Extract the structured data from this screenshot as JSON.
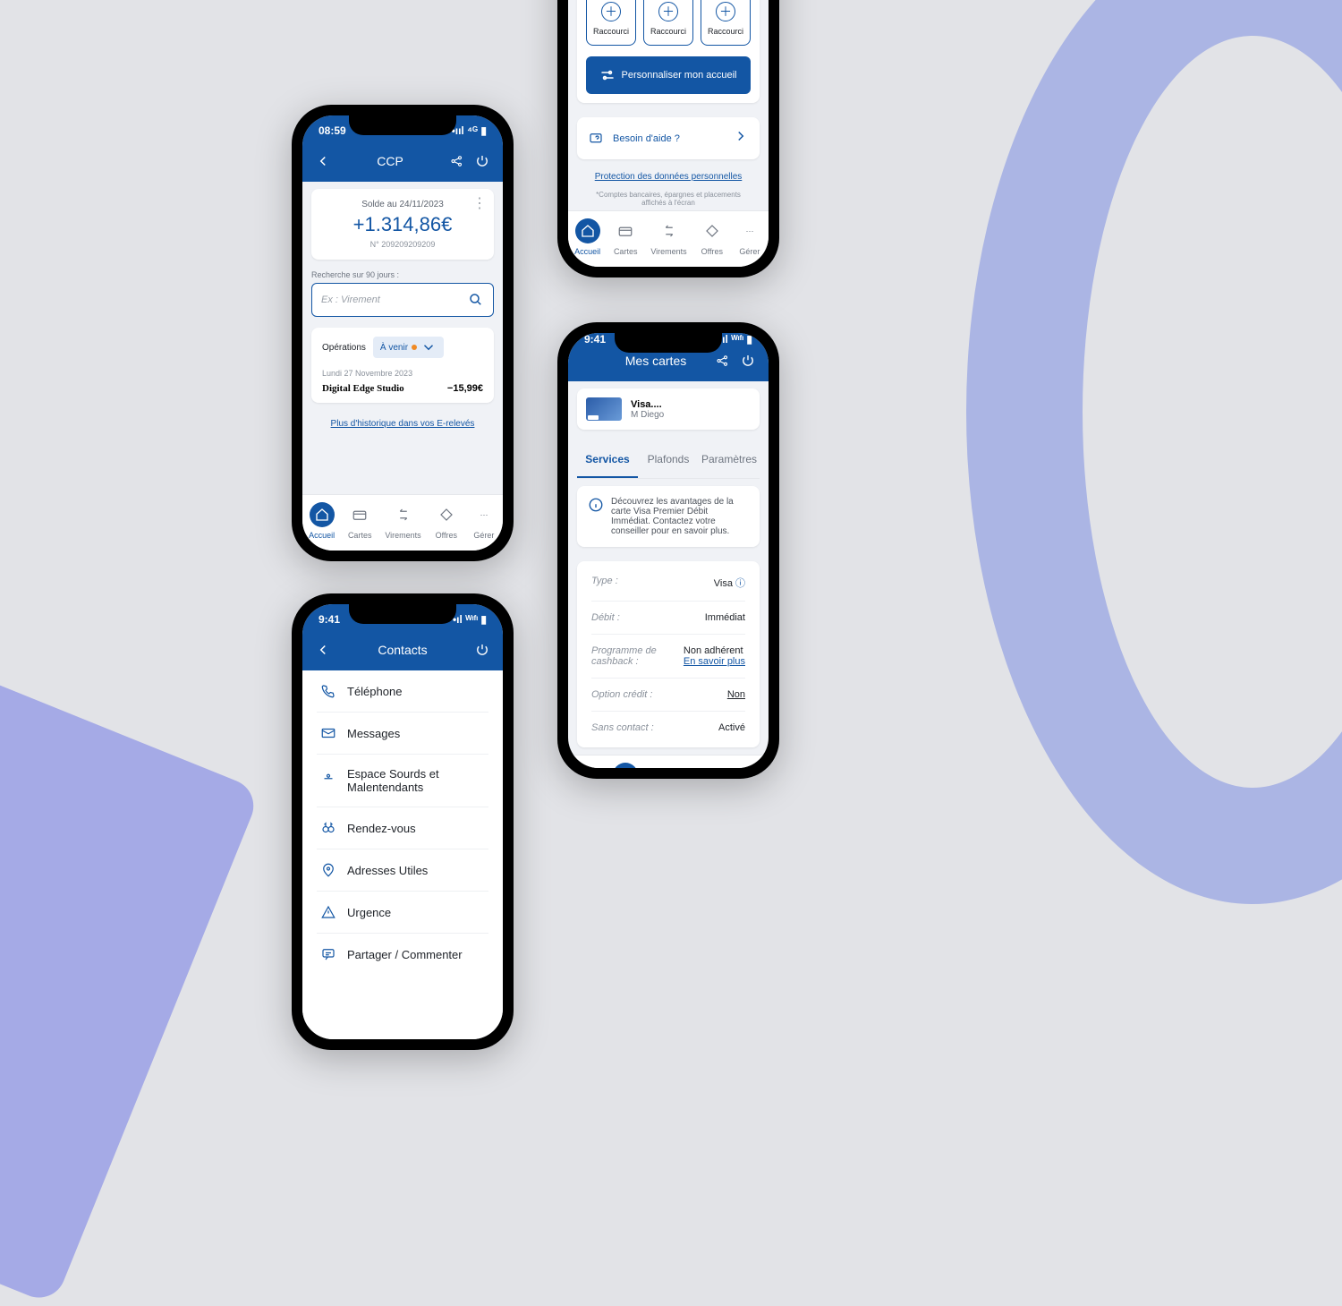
{
  "status": {
    "time1": "08:59",
    "time2": "9:41"
  },
  "tabs": [
    "Accueil",
    "Cartes",
    "Virements",
    "Offres",
    "Gérer"
  ],
  "ccp": {
    "title": "CCP",
    "balanceLabel": "Solde au 24/11/2023",
    "balance": "+1.314,86€",
    "acct": "N° 209209209209",
    "searchLabel": "Recherche sur 90 jours :",
    "searchPh": "Ex : Virement",
    "opsLabel": "Opérations",
    "upcoming": "À venir",
    "date": "Lundi 27 Novembre 2023",
    "merchant": "Digital Edge Studio",
    "amount": "−15,99€",
    "more": "Plus d'historique dans vos E-relevés"
  },
  "home": {
    "shortcut": "Raccourci",
    "personalize": "Personnaliser mon accueil",
    "help": "Besoin d'aide ?",
    "privacy": "Protection des données personnelles",
    "note": "*Comptes bancaires, épargnes et placements affichés à l'écran"
  },
  "cards": {
    "title": "Mes cartes",
    "cardName": "Visa....",
    "holder": "M Diego",
    "tabs": [
      "Services",
      "Plafonds",
      "Paramètres"
    ],
    "info": "Découvrez les avantages de la carte Visa Premier Débit Immédiat. Contactez votre conseiller pour en savoir plus.",
    "kv": [
      {
        "k": "Type :",
        "v": "Visa"
      },
      {
        "k": "Débit :",
        "v": "Immédiat"
      },
      {
        "k": "Programme de cashback :",
        "v": "Non adhérent",
        "link": "En savoir plus"
      },
      {
        "k": "Option crédit :",
        "v": "Non",
        "isLink": true
      },
      {
        "k": "Sans contact :",
        "v": "Activé"
      }
    ]
  },
  "contacts": {
    "title": "Contacts",
    "items": [
      "Téléphone",
      "Messages",
      "Espace Sourds et Malentendants",
      "Rendez-vous",
      "Adresses Utiles",
      "Urgence",
      "Partager / Commenter"
    ]
  }
}
